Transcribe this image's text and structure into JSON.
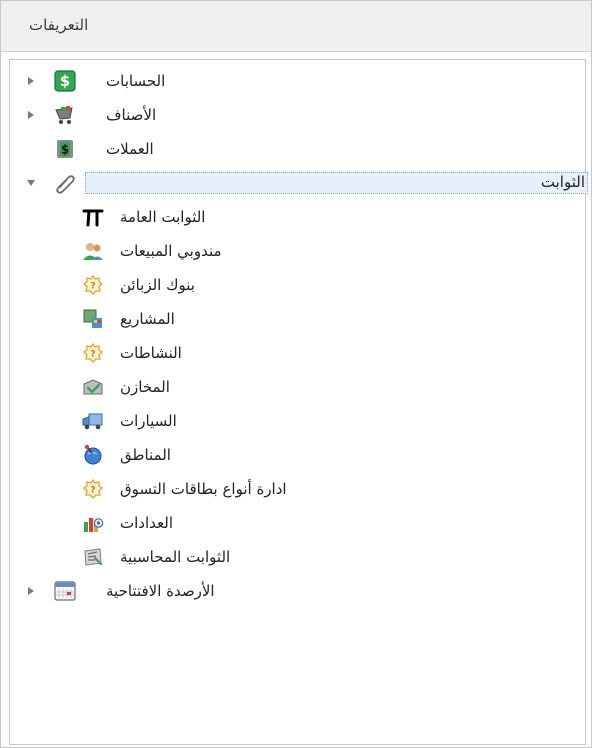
{
  "panel": {
    "title": "التعريفات"
  },
  "tree": {
    "items": [
      {
        "label": "الحسابات",
        "icon": "dollar-icon",
        "expander": "collapsed"
      },
      {
        "label": "الأصناف",
        "icon": "shopping-cart-icon",
        "expander": "collapsed"
      },
      {
        "label": "العملات",
        "icon": "currency-icon"
      },
      {
        "label": "الثوابت",
        "icon": "paperclip-icon",
        "expander": "expanded",
        "selected": true
      },
      {
        "label": "الثوابت العامة",
        "icon": "pi-icon"
      },
      {
        "label": "مندوبي المبيعات",
        "icon": "salespeople-icon"
      },
      {
        "label": "بنوك الزبائن",
        "icon": "question-badge-icon"
      },
      {
        "label": "المشاريع",
        "icon": "projects-icon"
      },
      {
        "label": "النشاطات",
        "icon": "question-badge-icon"
      },
      {
        "label": "المخازن",
        "icon": "warehouse-icon"
      },
      {
        "label": "السيارات",
        "icon": "truck-icon"
      },
      {
        "label": "المناطق",
        "icon": "globe-pin-icon"
      },
      {
        "label": "ادارة أنواع بطاقات التسوق",
        "icon": "question-badge-icon"
      },
      {
        "label": "العدادات",
        "icon": "counter-chart-icon"
      },
      {
        "label": "الثوابت المحاسبية",
        "icon": "accounting-icon"
      },
      {
        "label": "الأرصدة الافتتاحية",
        "icon": "calendar-table-icon",
        "expander": "collapsed"
      }
    ]
  },
  "colors": {
    "green": "#2fa84f",
    "selected_border": "#7aa7d8",
    "selected_fill": "#e6f0fb",
    "question_orange": "#f0a020"
  }
}
